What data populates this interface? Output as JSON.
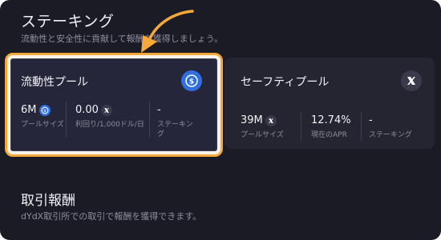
{
  "header": {
    "title": "ステーキング",
    "subtitle": "流動性と安全性に貢献して報酬を獲得しましょう。"
  },
  "liquidity_pool": {
    "title": "流動性プール",
    "icon": "usdc-icon",
    "stats": [
      {
        "value": "6M",
        "label": "プールサイズ",
        "icon": "usdc-icon"
      },
      {
        "value": "0.00",
        "label": "利回り/1,000ドル/日",
        "icon": "dydx-icon"
      },
      {
        "value": "-",
        "label": "ステーキング"
      }
    ]
  },
  "safety_pool": {
    "title": "セーフティプール",
    "icon": "dydx-icon",
    "stats": [
      {
        "value": "39M",
        "label": "プールサイズ",
        "icon": "dydx-icon"
      },
      {
        "value": "12.74%",
        "label": "現在のAPR"
      },
      {
        "value": "-",
        "label": "ステーキング"
      }
    ]
  },
  "trading_rewards": {
    "title": "取引報酬",
    "subtitle": "dYdX取引所での取引で報酬を獲得できます。"
  },
  "colors": {
    "background": "#1b1b26",
    "card": "#252532",
    "highlight_border": "#f6a93b",
    "usdc": "#2f6fe0",
    "dydx": "#3a3a4c"
  }
}
